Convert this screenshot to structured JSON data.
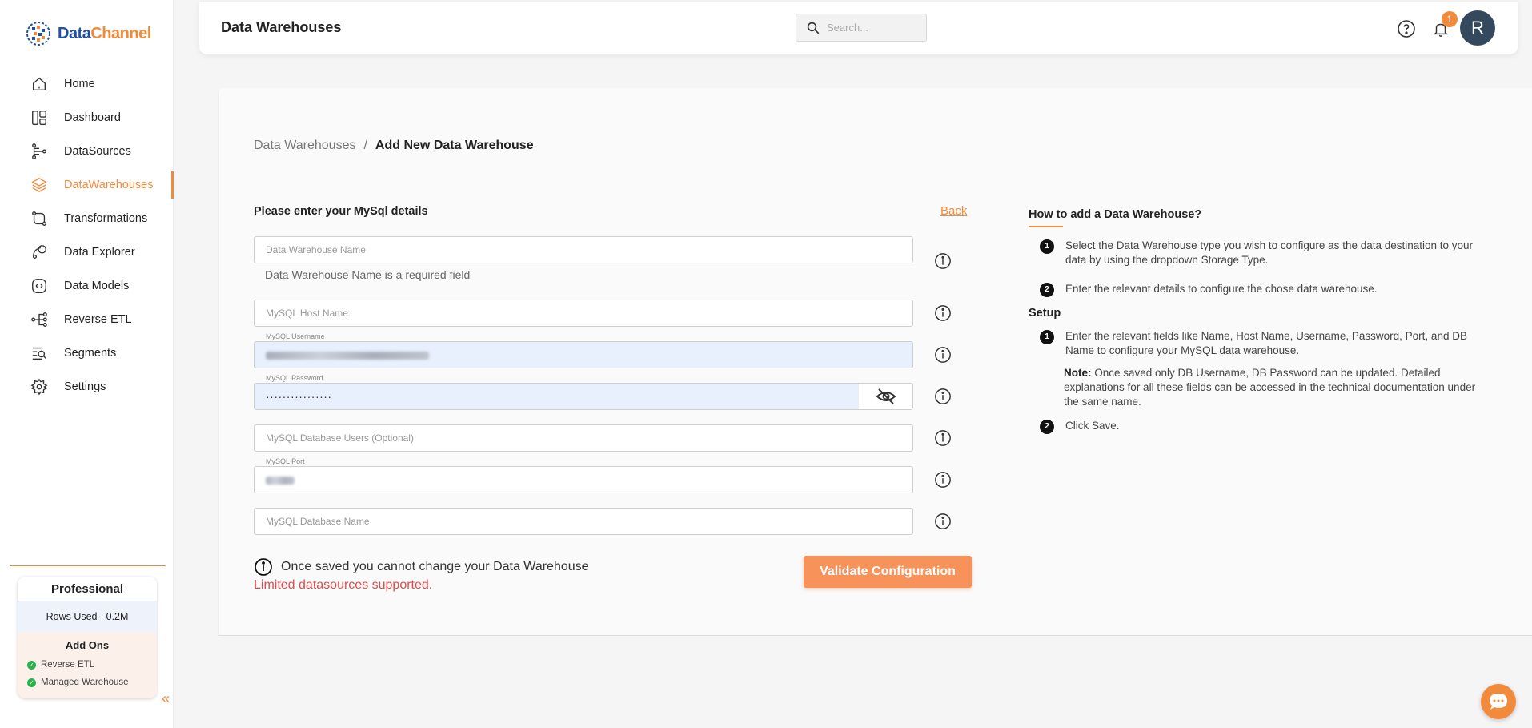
{
  "brand": {
    "name_part1": "Data",
    "name_part2": "Channel",
    "accent": "#f28a3c",
    "primary": "#1e4fa0"
  },
  "sidebar": {
    "items": [
      {
        "label": "Home",
        "icon": "home-icon"
      },
      {
        "label": "Dashboard",
        "icon": "dashboard-icon"
      },
      {
        "label": "DataSources",
        "icon": "datasources-icon"
      },
      {
        "label": "DataWarehouses",
        "icon": "layers-icon",
        "active": true
      },
      {
        "label": "Transformations",
        "icon": "transform-icon"
      },
      {
        "label": "Data Explorer",
        "icon": "explorer-icon"
      },
      {
        "label": "Data Models",
        "icon": "models-icon"
      },
      {
        "label": "Reverse ETL",
        "icon": "reverse-etl-icon"
      },
      {
        "label": "Segments",
        "icon": "segments-icon"
      },
      {
        "label": "Settings",
        "icon": "gear-icon"
      }
    ],
    "plan": {
      "title": "Professional",
      "rows_used": "Rows Used - 0.2M",
      "addons_title": "Add Ons",
      "addons": [
        "Reverse ETL",
        "Managed Warehouse"
      ]
    },
    "collapse_glyph": "«"
  },
  "topbar": {
    "title": "Data Warehouses",
    "search_placeholder": "Search...",
    "notification_count": "1",
    "avatar_initial": "R"
  },
  "breadcrumb": {
    "parent": "Data Warehouses",
    "separator": "/",
    "current": "Add New Data Warehouse"
  },
  "form": {
    "title": "Please enter your MySql details",
    "back_label": "Back",
    "name_placeholder": "Data Warehouse Name",
    "name_error": "Data Warehouse Name is a required field",
    "host_placeholder": "MySQL Host Name",
    "username_label": "MySQL Username",
    "password_label": "MySQL Password",
    "password_value": "················",
    "db_users_placeholder": "MySQL Database Users (Optional)",
    "port_label": "MySQL Port",
    "db_name_placeholder": "MySQL Database Name",
    "note": "Once saved you cannot change your Data Warehouse",
    "limited": "Limited datasources supported.",
    "validate_label": "Validate Configuration"
  },
  "help": {
    "title": "How to add a Data Warehouse?",
    "steps": [
      {
        "num": "1",
        "text": "Select the Data Warehouse type you wish to configure as the data destination to your data by using the dropdown Storage Type."
      },
      {
        "num": "2",
        "text": "Enter the relevant details to configure the chose data warehouse."
      }
    ],
    "setup_title": "Setup",
    "setup_steps": [
      {
        "num": "1",
        "text": "Enter the relevant fields like Name, Host Name, Username, Password, Port, and DB Name to configure your MySQL data warehouse."
      },
      {
        "num": "2",
        "text": "Click Save."
      }
    ],
    "note_label": "Note:",
    "note_text": " Once saved only DB Username, DB Password can be updated. Detailed explanations for all these fields can be accessed in the technical documentation under the same name."
  }
}
